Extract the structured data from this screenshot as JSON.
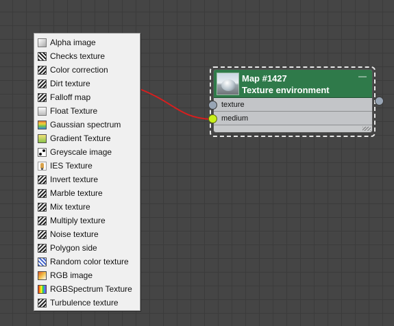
{
  "menu": {
    "items": [
      {
        "label": "Alpha image",
        "icon": "alpha-image-icon"
      },
      {
        "label": "Checks texture",
        "icon": "checks-texture-icon"
      },
      {
        "label": "Color correction",
        "icon": "color-correction-icon"
      },
      {
        "label": "Dirt texture",
        "icon": "dirt-texture-icon"
      },
      {
        "label": "Falloff map",
        "icon": "falloff-map-icon"
      },
      {
        "label": "Float Texture",
        "icon": "float-texture-icon"
      },
      {
        "label": "Gaussian spectrum",
        "icon": "gaussian-spectrum-icon"
      },
      {
        "label": "Gradient Texture",
        "icon": "gradient-texture-icon"
      },
      {
        "label": "Greyscale image",
        "icon": "greyscale-image-icon"
      },
      {
        "label": "IES Texture",
        "icon": "ies-texture-icon"
      },
      {
        "label": "Invert texture",
        "icon": "invert-texture-icon"
      },
      {
        "label": "Marble texture",
        "icon": "marble-texture-icon"
      },
      {
        "label": "Mix texture",
        "icon": "mix-texture-icon"
      },
      {
        "label": "Multiply texture",
        "icon": "multiply-texture-icon"
      },
      {
        "label": "Noise texture",
        "icon": "noise-texture-icon"
      },
      {
        "label": "Polygon side",
        "icon": "polygon-side-icon"
      },
      {
        "label": "Random color texture",
        "icon": "random-color-texture-icon"
      },
      {
        "label": "RGB image",
        "icon": "rgb-image-icon"
      },
      {
        "label": "RGBSpectrum Texture",
        "icon": "rgbspectrum-texture-icon"
      },
      {
        "label": "Turbulence texture",
        "icon": "turbulence-texture-icon"
      }
    ]
  },
  "node": {
    "title": "Map #1427",
    "subtitle": "Texture environment",
    "collapse_symbol": "—",
    "header_color": "#2f7a4a",
    "ports": [
      {
        "label": "texture",
        "color": "#98a5b5"
      },
      {
        "label": "medium",
        "color": "#c9f01c"
      }
    ]
  },
  "wire_color": "#e02020"
}
